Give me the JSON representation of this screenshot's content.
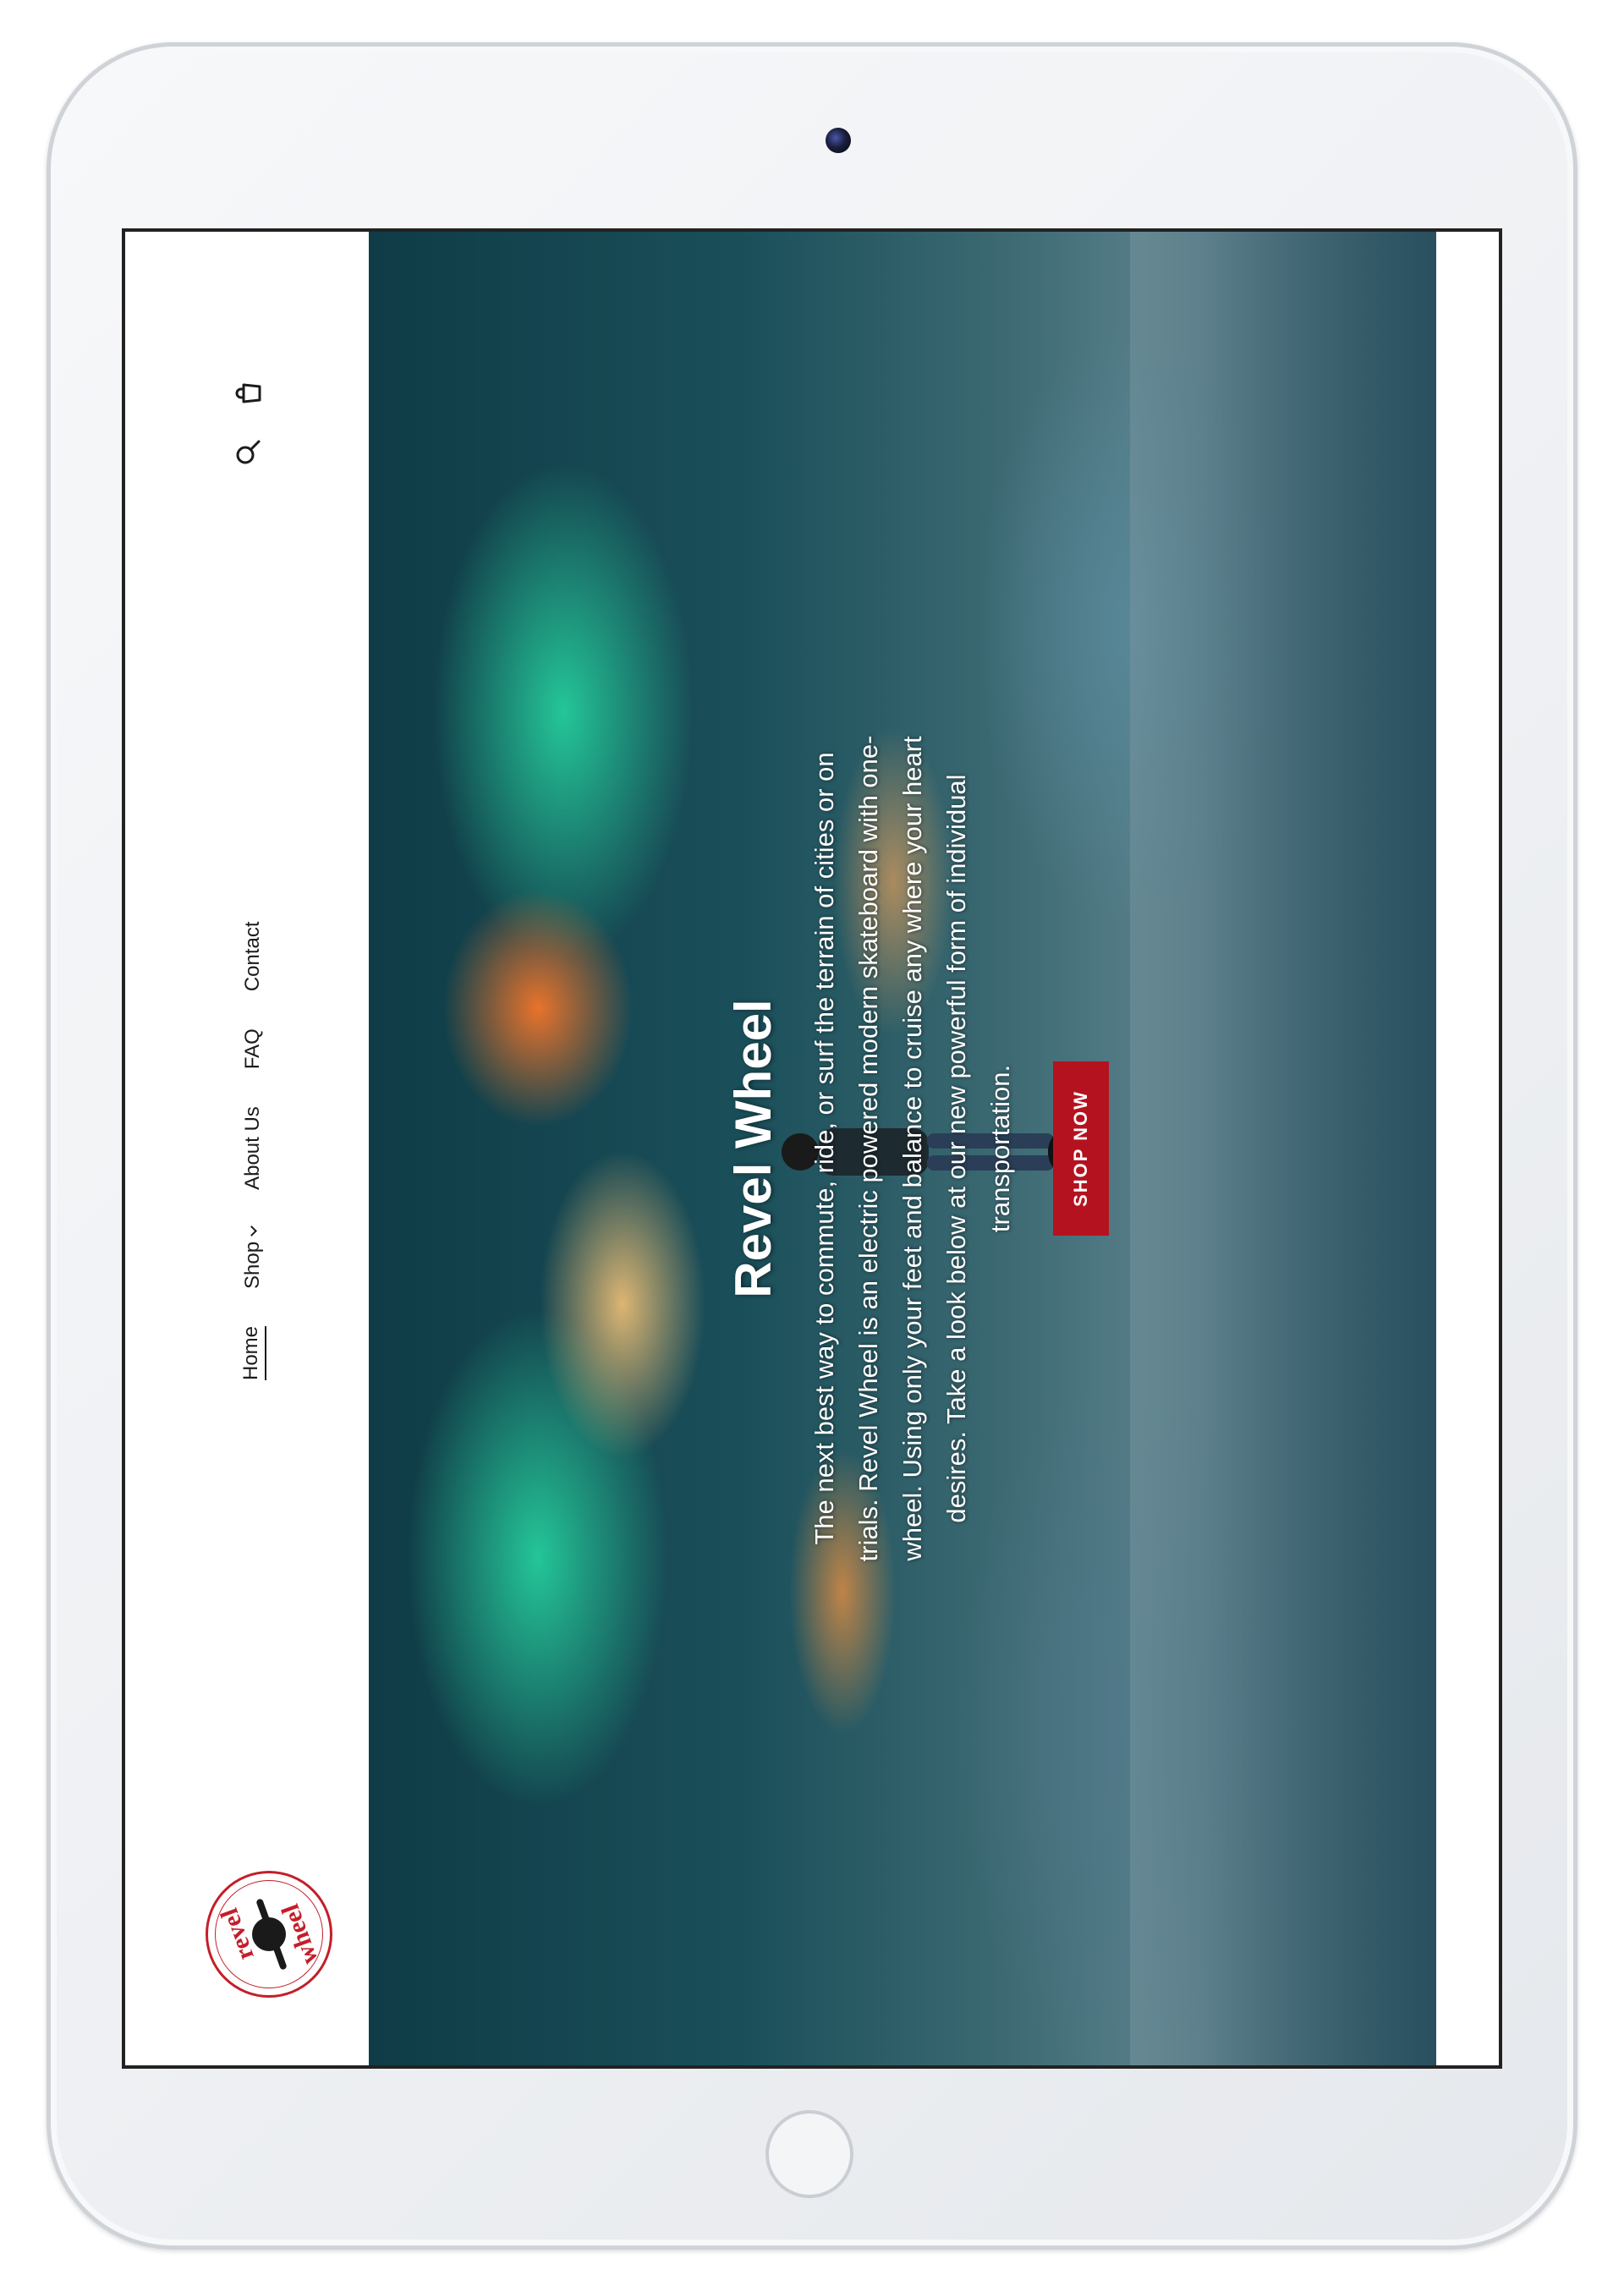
{
  "header": {
    "logo": {
      "text_top": "revel",
      "text_bottom": "wheel"
    },
    "nav": [
      {
        "label": "Home",
        "active": true
      },
      {
        "label": "Shop",
        "has_dropdown": true
      },
      {
        "label": "About Us"
      },
      {
        "label": "FAQ"
      },
      {
        "label": "Contact"
      }
    ],
    "icons": [
      "search-icon",
      "cart-icon"
    ]
  },
  "hero": {
    "title": "Revel Wheel",
    "description": "The next best way to commute, ride, or surf the terrain of cities or on trials. Revel Wheel is an electric powered modern skateboard with one-wheel. Using only your feet and balance to cruise any where your heart desires. Take a look below at our new powerful form of individual transportation.",
    "button_label": "SHOP NOW"
  },
  "colors": {
    "brand_red": "#b5121f",
    "logo_red": "#c41e2a"
  }
}
